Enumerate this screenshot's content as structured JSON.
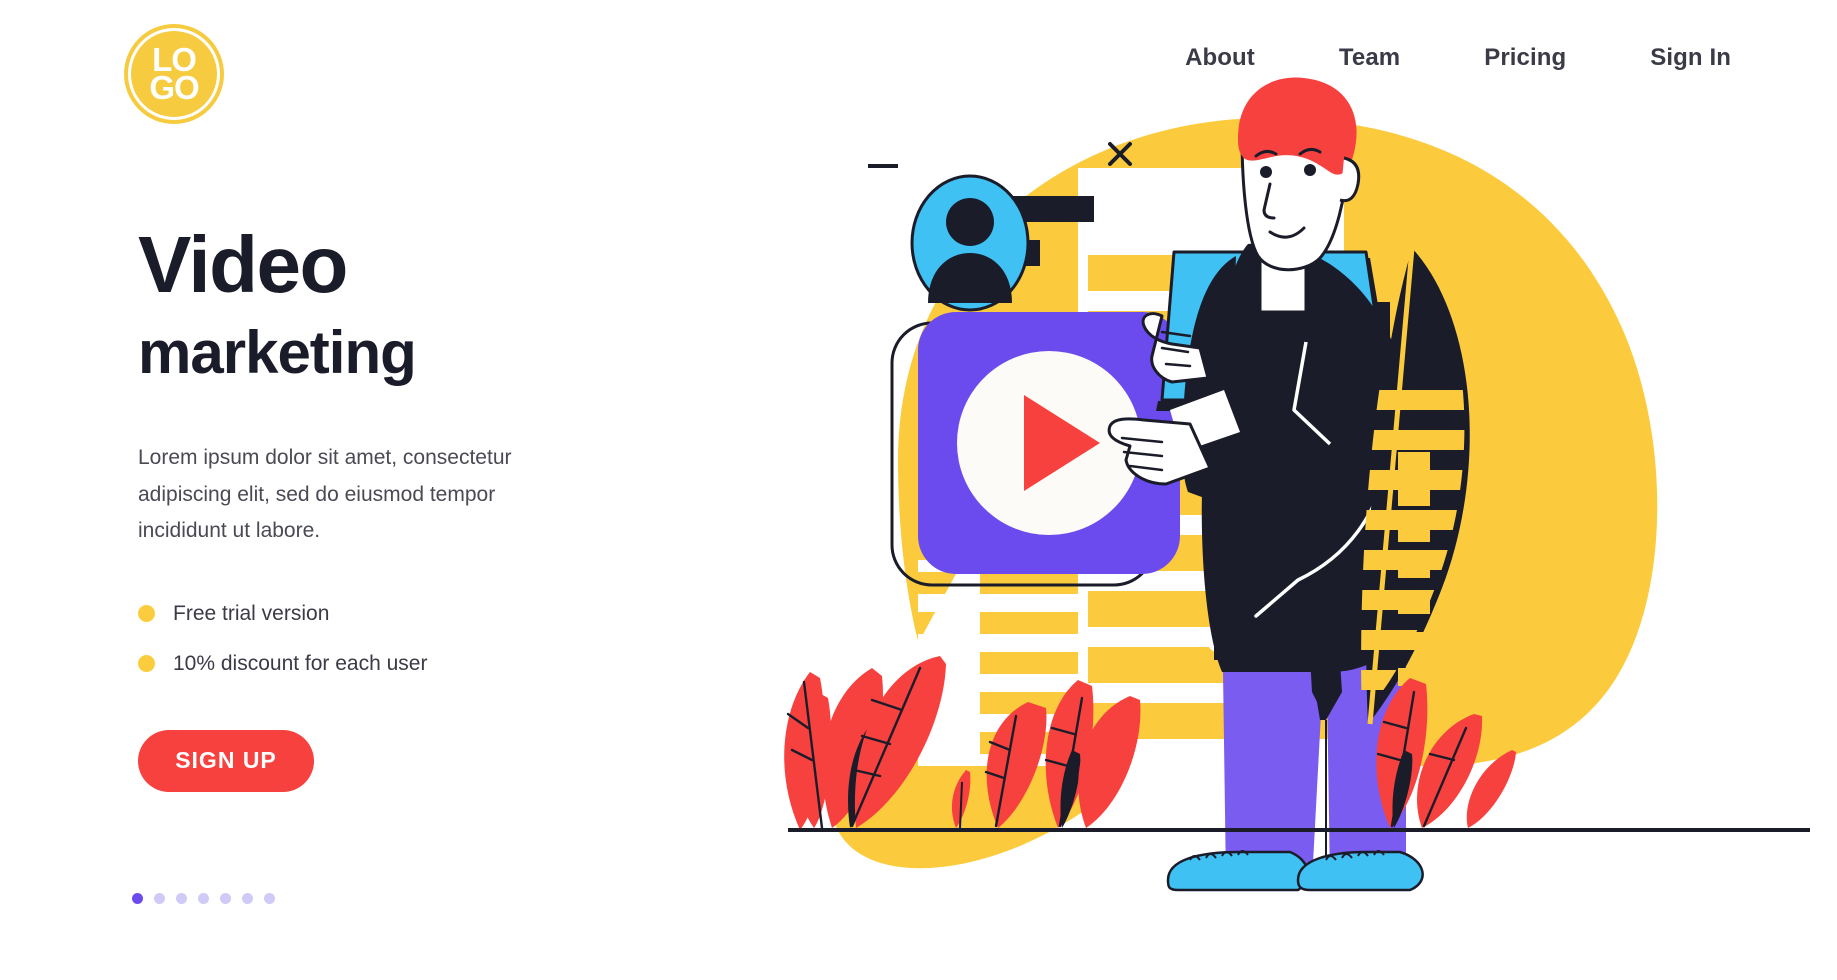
{
  "brand": {
    "logo_line1": "LO",
    "logo_line2": "GO",
    "logo_color": "#F7CB3F"
  },
  "nav": {
    "items": [
      {
        "label": "About"
      },
      {
        "label": "Team"
      },
      {
        "label": "Pricing"
      },
      {
        "label": "Sign In"
      }
    ]
  },
  "hero": {
    "title_line1": "Video",
    "title_line2": "marketing",
    "paragraph": "Lorem ipsum dolor sit amet, consectetur adipiscing elit, sed do eiusmod tempor incididunt ut labore.",
    "features": [
      {
        "label": "Free trial version"
      },
      {
        "label": "10% discount for each user"
      }
    ],
    "cta_label": "SIGN UP"
  },
  "carousel": {
    "total_dots": 7,
    "active_index": 0,
    "active_color": "#6C4BEE",
    "inactive_color": "#CFCAF6"
  },
  "colors": {
    "yellow": "#FBCB3D",
    "yellow_soft": "#F9CC3C",
    "purple": "#6C4BEE",
    "blue": "#3FC1F3",
    "red": "#F7413F",
    "dark": "#1B1C2A",
    "white": "#FFFFFF",
    "text": "#3B3B47"
  },
  "illustration": {
    "name": "video-marketing-illustration",
    "elements": [
      {
        "name": "yellow-backdrop-blob"
      },
      {
        "name": "document-card"
      },
      {
        "name": "avatar-bubble"
      },
      {
        "name": "minimize-icon"
      },
      {
        "name": "close-icon"
      },
      {
        "name": "video-play-card"
      },
      {
        "name": "play-triangle-icon"
      },
      {
        "name": "laptop"
      },
      {
        "name": "person-character"
      },
      {
        "name": "leaf-plants"
      },
      {
        "name": "ground-line"
      }
    ]
  }
}
